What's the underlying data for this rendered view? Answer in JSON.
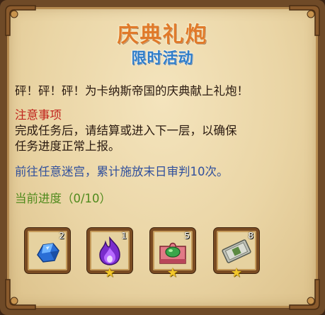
{
  "panel": {
    "title": "庆典礼炮",
    "subtitle": "限时活动",
    "description": "砰！砰！砰！为卡纳斯帝国的庆典献上礼炮！",
    "notice_heading": "注意事项",
    "notice_line1": "完成任务后，请结算或进入下一层，以确保",
    "notice_line2": "任务进度正常上报。",
    "task": "前往任意迷宫，累计施放末日审判10次。",
    "progress": "当前进度（0/10）"
  },
  "rewards": [
    {
      "icon": "blue-crystal-icon",
      "count": "2",
      "starred": false
    },
    {
      "icon": "purple-flame-icon",
      "count": "1",
      "starred": true
    },
    {
      "icon": "puzzle-gem-icon",
      "count": "5",
      "starred": true
    },
    {
      "icon": "ticket-icon",
      "count": "8",
      "starred": true
    }
  ],
  "colors": {
    "title": "#e07a2a",
    "subtitle": "#2f7dc9",
    "notice": "#c0231c",
    "task": "#31509c",
    "progress": "#4f8a1c"
  }
}
